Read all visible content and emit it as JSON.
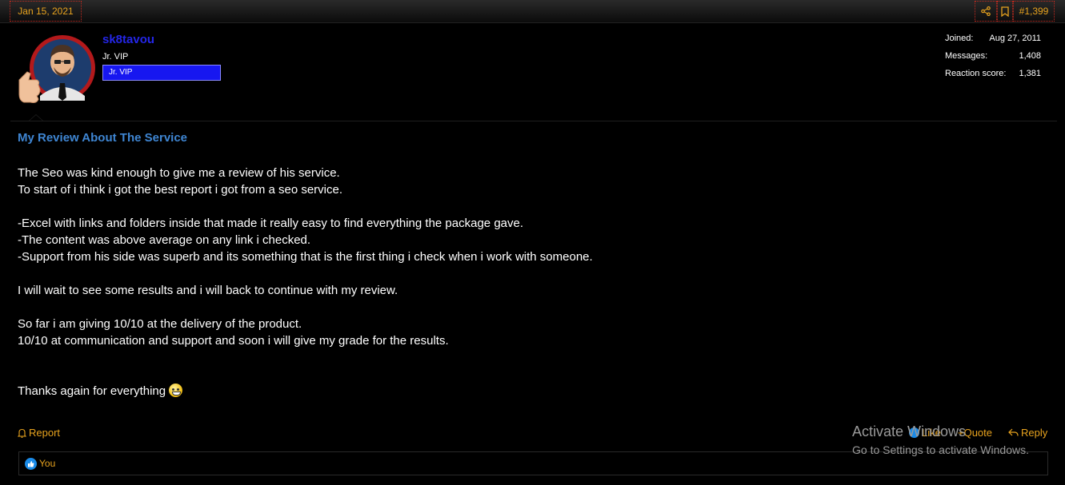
{
  "post": {
    "date": "Jan 15, 2021",
    "number": "#1,399",
    "share_icon": "share-icon",
    "bookmark_icon": "bookmark-icon"
  },
  "user": {
    "name": "sk8tavou",
    "title": "Jr. VIP",
    "badge": "Jr. VIP",
    "badge_color": "#1717f0",
    "stats": [
      {
        "label": "Joined:",
        "value": "Aug 27, 2011"
      },
      {
        "label": "Messages:",
        "value": "1,408"
      },
      {
        "label": "Reaction score:",
        "value": "1,381"
      }
    ]
  },
  "content": {
    "title": "My Review About The Service",
    "lines": [
      "The Seo was kind enough to give me a review of his service.",
      "To start of i think i got the best report i got from a seo service.",
      "",
      "-Excel with links and folders inside that made it really easy to find everything the package gave.",
      "-The content was above average on any link i checked.",
      "-Support from his side was superb and its something that is the first thing i check when i work with someone.",
      "",
      "I will wait to see some results and i will back to continue with my review.",
      "",
      "So far i am giving 10/10 at the delivery of the product.",
      "10/10 at communication and support and soon i will give my grade for the results.",
      "",
      "",
      "Thanks again for everything"
    ]
  },
  "actions": {
    "report": "Report",
    "like": "Like",
    "quote": "+Quote",
    "reply": "Reply"
  },
  "reactions": {
    "text": "You"
  },
  "watermark": {
    "line1": "Activate Windows",
    "line2": "Go to Settings to activate Windows."
  },
  "colors": {
    "accent": "#e8a31e",
    "title_blue": "#3f86d3",
    "username_blue": "#2426e8"
  }
}
